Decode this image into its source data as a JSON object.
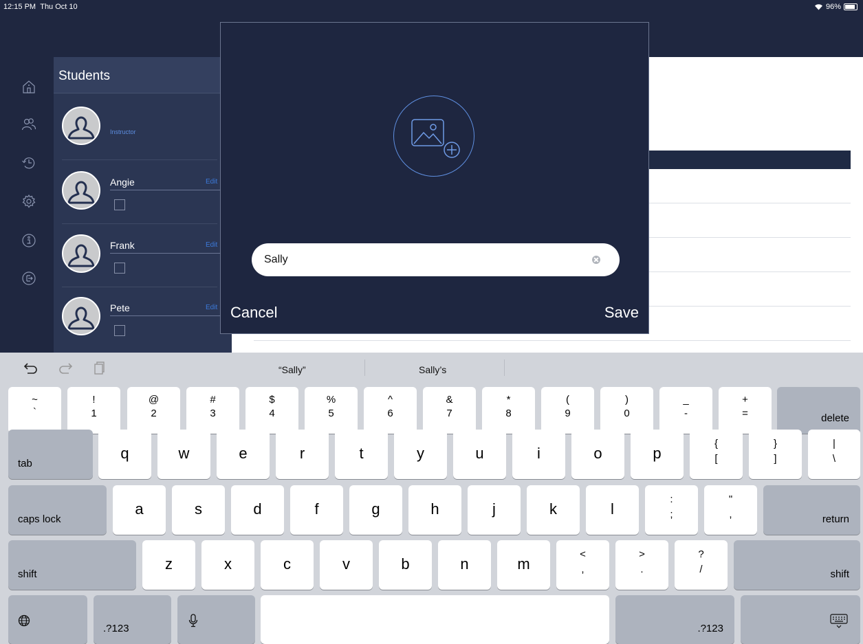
{
  "status": {
    "time": "12:15 PM",
    "date": "Thu Oct 10",
    "battery": "96%",
    "wifi_icon": "wifi-icon"
  },
  "sidebar": {
    "icons": [
      "home-icon",
      "people-icon",
      "history-icon",
      "gear-icon",
      "info-icon",
      "logout-icon"
    ]
  },
  "students_panel": {
    "title": "Students",
    "instructor_label": "Instructor",
    "edit_label": "Edit",
    "students": [
      {
        "name": "Angie"
      },
      {
        "name": "Frank"
      },
      {
        "name": "Pete"
      }
    ]
  },
  "modal": {
    "name_value": "Sally",
    "cancel_label": "Cancel",
    "save_label": "Save",
    "photo_icon": "add-photo-icon"
  },
  "keyboard": {
    "suggestions": [
      "“Sally”",
      "Sally’s"
    ],
    "toolbar_icons": [
      "undo-icon",
      "redo-icon",
      "paste-icon"
    ],
    "row1": [
      {
        "top": "~",
        "bottom": "`"
      },
      {
        "top": "!",
        "bottom": "1"
      },
      {
        "top": "@",
        "bottom": "2"
      },
      {
        "top": "#",
        "bottom": "3"
      },
      {
        "top": "$",
        "bottom": "4"
      },
      {
        "top": "%",
        "bottom": "5"
      },
      {
        "top": "^",
        "bottom": "6"
      },
      {
        "top": "&",
        "bottom": "7"
      },
      {
        "top": "*",
        "bottom": "8"
      },
      {
        "top": "(",
        "bottom": "9"
      },
      {
        "top": ")",
        "bottom": "0"
      },
      {
        "top": "_",
        "bottom": "-"
      },
      {
        "top": "+",
        "bottom": "="
      }
    ],
    "row2": [
      "q",
      "w",
      "e",
      "r",
      "t",
      "y",
      "u",
      "i",
      "o",
      "p"
    ],
    "row2_pairs": [
      {
        "top": "{",
        "bottom": "["
      },
      {
        "top": "}",
        "bottom": "]"
      },
      {
        "top": "|",
        "bottom": "\\"
      }
    ],
    "row3": [
      "a",
      "s",
      "d",
      "f",
      "g",
      "h",
      "j",
      "k",
      "l"
    ],
    "row3_pairs": [
      {
        "top": ":",
        "bottom": ";"
      },
      {
        "top": "\"",
        "bottom": ","
      }
    ],
    "row4": [
      "z",
      "x",
      "c",
      "v",
      "b",
      "n",
      "m"
    ],
    "row4_pairs": [
      {
        "top": "<",
        "bottom": ","
      },
      {
        "top": ">",
        "bottom": "."
      },
      {
        "top": "?",
        "bottom": "/"
      }
    ],
    "labels": {
      "delete": "delete",
      "tab": "tab",
      "caps": "caps lock",
      "return": "return",
      "shift": "shift",
      "numbers": ".?123"
    },
    "icons": {
      "globe": "globe-icon",
      "mic": "microphone-icon",
      "hide": "keyboard-hide-icon"
    }
  }
}
